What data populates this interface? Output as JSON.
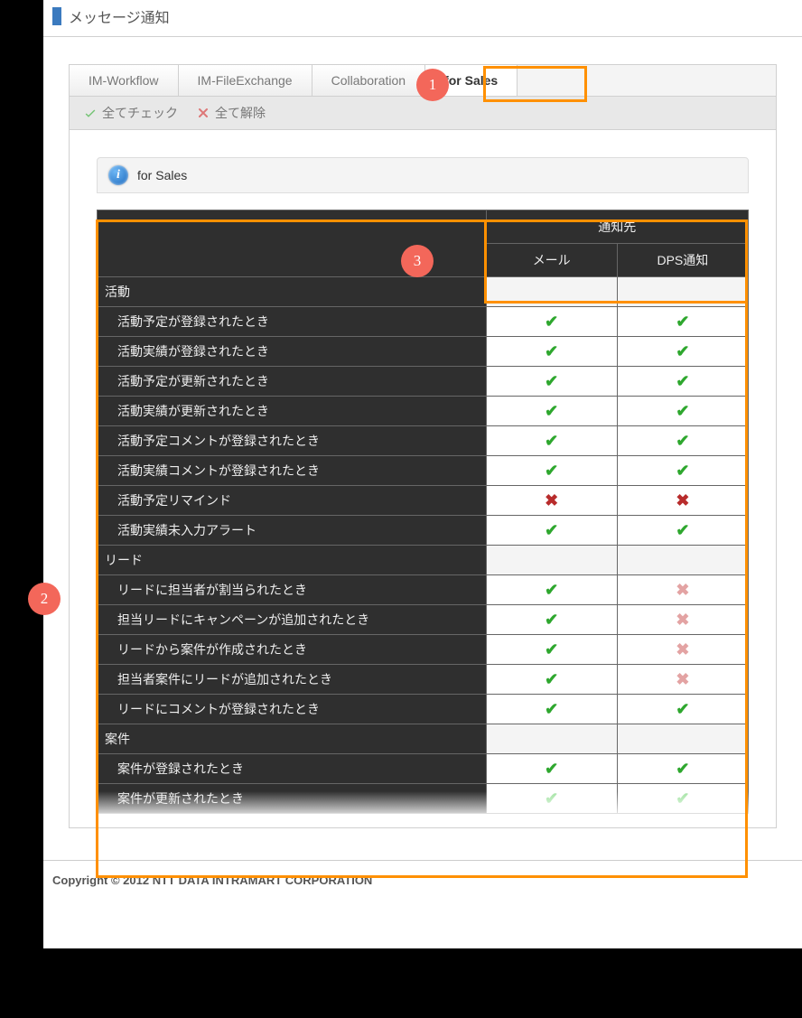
{
  "header": {
    "title": "メッセージ通知"
  },
  "tabs": [
    {
      "label": "IM-Workflow"
    },
    {
      "label": "IM-FileExchange"
    },
    {
      "label": "Collaboration"
    },
    {
      "label": "for Sales"
    }
  ],
  "toolbar": {
    "check_all": "全てチェック",
    "uncheck_all": "全て解除"
  },
  "section": {
    "label": "for Sales"
  },
  "table": {
    "head_blank": "",
    "head_group": "通知先",
    "head_mail": "メール",
    "head_dps": "DPS通知",
    "groups": [
      {
        "label": "活動",
        "rows": [
          {
            "label": "活動予定が登録されたとき",
            "mail": "on",
            "dps": "on"
          },
          {
            "label": "活動実績が登録されたとき",
            "mail": "on",
            "dps": "on"
          },
          {
            "label": "活動予定が更新されたとき",
            "mail": "on",
            "dps": "on"
          },
          {
            "label": "活動実績が更新されたとき",
            "mail": "on",
            "dps": "on"
          },
          {
            "label": "活動予定コメントが登録されたとき",
            "mail": "on",
            "dps": "on"
          },
          {
            "label": "活動実績コメントが登録されたとき",
            "mail": "on",
            "dps": "on"
          },
          {
            "label": "活動予定リマインド",
            "mail": "off",
            "dps": "off"
          },
          {
            "label": "活動実績未入力アラート",
            "mail": "on",
            "dps": "on"
          }
        ]
      },
      {
        "label": "リード",
        "rows": [
          {
            "label": "リードに担当者が割当られたとき",
            "mail": "on",
            "dps": "disabled-off"
          },
          {
            "label": "担当リードにキャンペーンが追加されたとき",
            "mail": "on",
            "dps": "disabled-off"
          },
          {
            "label": "リードから案件が作成されたとき",
            "mail": "on",
            "dps": "disabled-off"
          },
          {
            "label": "担当者案件にリードが追加されたとき",
            "mail": "on",
            "dps": "disabled-off"
          },
          {
            "label": "リードにコメントが登録されたとき",
            "mail": "on",
            "dps": "on"
          }
        ]
      },
      {
        "label": "案件",
        "rows": [
          {
            "label": "案件が登録されたとき",
            "mail": "on",
            "dps": "on"
          },
          {
            "label": "案件が更新されたとき",
            "mail": "disabled-on",
            "dps": "disabled-on"
          }
        ]
      }
    ]
  },
  "callouts": {
    "one": "1",
    "two": "2",
    "three": "3"
  },
  "footer": {
    "copyright": "Copyright © 2012 NTT DATA INTRAMART CORPORATION"
  }
}
